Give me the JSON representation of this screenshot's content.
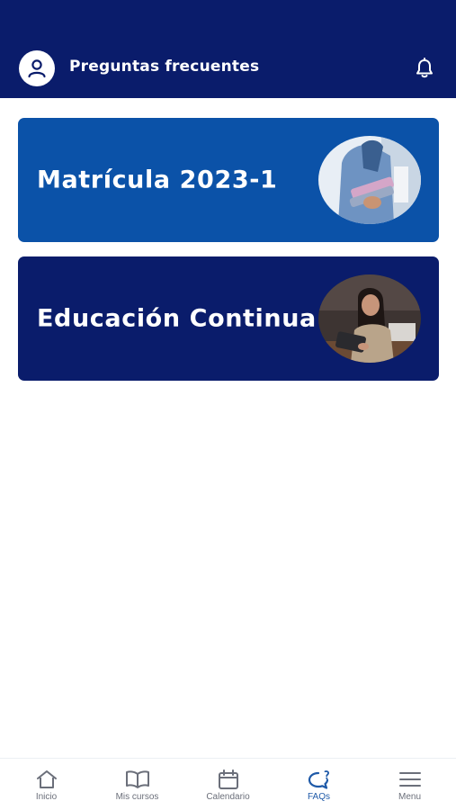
{
  "header": {
    "title": "Preguntas frecuentes",
    "avatar_icon": "user-icon",
    "notification_icon": "bell-icon"
  },
  "cards": [
    {
      "label": "Matrícula 2023-1",
      "image": "student-holding-books-photo",
      "color": "#0b52a8"
    },
    {
      "label": "Educación Continua",
      "image": "woman-with-tablet-photo",
      "color": "#0a1c6b"
    }
  ],
  "tabbar": {
    "items": [
      {
        "label": "Inicio",
        "icon": "home-icon",
        "active": false
      },
      {
        "label": "Mis cursos",
        "icon": "book-icon",
        "active": false
      },
      {
        "label": "Calendario",
        "icon": "calendar-icon",
        "active": false
      },
      {
        "label": "FAQs",
        "icon": "faq-chat-icon",
        "active": true
      },
      {
        "label": "Menu",
        "icon": "hamburger-icon",
        "active": false
      }
    ]
  },
  "colors": {
    "header_bg": "#0a1c6b",
    "accent": "#1f5aa8",
    "inactive_tab": "#6b6f7a"
  }
}
